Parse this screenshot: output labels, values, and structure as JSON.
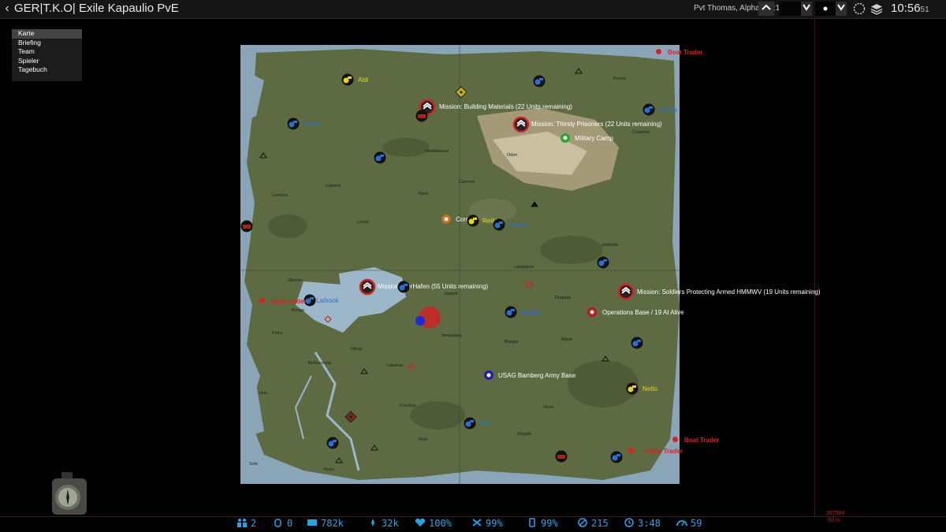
{
  "topbar": {
    "server_title": "GER|T.K.O| Exile Kapaulio PvE",
    "player": "Pvt Thomas, Alpha 1-2:1",
    "clock_main": "10:56",
    "clock_seconds": "51"
  },
  "menu": {
    "items": [
      "Karte",
      "Briefing",
      "Team",
      "Spieler",
      "Tagebuch"
    ]
  },
  "map": {
    "missions": [
      "Mission: Building Materials (22 Units remaining)",
      "Mission: Thirsty Prisoners (22 Units remaining)",
      "Mission: DerHafen (55 Units remaining)",
      "Mission: Soldiers Protecting Armed HMMWV (19 Units remaining)"
    ],
    "points": {
      "military_camp": "Military Camp",
      "corona": "Corona",
      "operations_base": "Operations Base / 19 AI Alive",
      "usag": "USAG Bamberg Army Base"
    },
    "traders": {
      "aldi": "Aldi",
      "rewe": "ReWe",
      "netto": "Netto",
      "boat_trader": "Boat Trader",
      "plane_trader": "Plane Trader"
    },
    "blue_labels": {
      "anubis": "Anubis",
      "hawaii": "Hawaii",
      "bazaar": "Bazaar",
      "fern": "Fern",
      "zimba": "Zimba",
      "lathook": "Lathook"
    },
    "towns": {
      "perots": "Perots",
      "haddawassi": "Haddawassi",
      "oden": "Oden",
      "cancom": "Cancom",
      "kawi": "Kawi",
      "cabena": "Cabena",
      "luntana": "Luntana",
      "lundy": "Lundy",
      "jambola": "Jambola",
      "casatama": "casatama",
      "oborno": "Oborno",
      "jappoli": "Jappoli",
      "bonga": "Bonga",
      "ruguisa": "Ruguisa",
      "petra": "Petra",
      "jambalaya": "Jambalaya",
      "bangar": "Bangar",
      "mijutti": "Mijutti",
      "viking": "Viking",
      "bellacorona": "Bellacorona",
      "lahaina": "Lahaina",
      "hun": "Hun",
      "cachina": "Cachina",
      "nova": "Nova",
      "singalli": "Singalli",
      "ruto": "Ruto",
      "sole": "Sole",
      "kupu": "Kupu",
      "caserina": "Caserina"
    }
  },
  "statusbar": {
    "players": "2",
    "grenade": "0",
    "money": "782k",
    "respect": "32k",
    "health": "100%",
    "repair": "99%",
    "hunger": "99%",
    "speed": "215",
    "time": "3:48",
    "fps": "59"
  },
  "coords": {
    "line1": "267984",
    "line2": "-50 m"
  },
  "colors": {
    "accent_blue": "#2aa3e6",
    "trader_yellow": "#e8d41a",
    "mission_red": "#d42020",
    "map_green": "#5e6a43"
  }
}
